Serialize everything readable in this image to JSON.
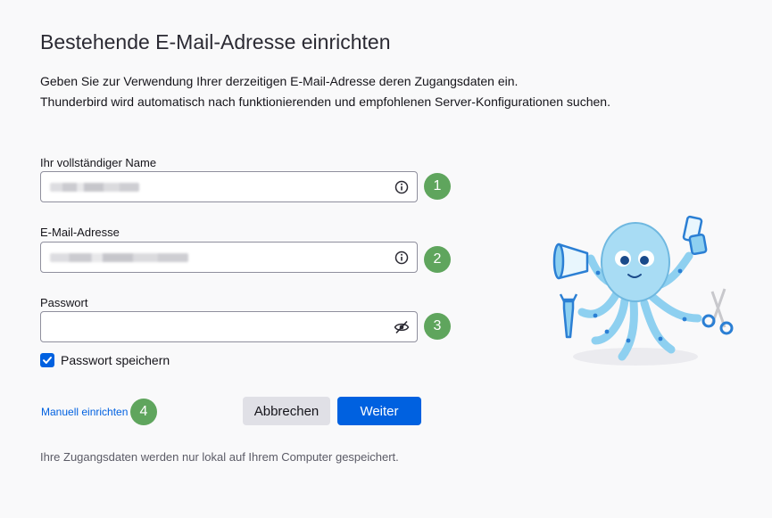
{
  "page": {
    "title": "Bestehende E-Mail-Adresse einrichten",
    "intro_line1": "Geben Sie zur Verwendung Ihrer derzeitigen E-Mail-Adresse deren Zugangsdaten ein.",
    "intro_line2": "Thunderbird wird automatisch nach funktionierenden und empfohlenen Server-Konfigurationen suchen."
  },
  "form": {
    "name_label": "Ihr vollständiger Name",
    "email_label": "E-Mail-Adresse",
    "password_label": "Passwort",
    "remember_label": "Passwort speichern",
    "remember_checked": true
  },
  "badges": [
    "1",
    "2",
    "3",
    "4"
  ],
  "actions": {
    "manual_label": "Manuell einrichten",
    "cancel_label": "Abbrechen",
    "next_label": "Weiter"
  },
  "footer": {
    "note": "Ihre Zugangsdaten werden nur lokal auf Ihrem Computer gespeichert."
  },
  "icons": {
    "name_field": "info-icon",
    "email_field": "info-icon",
    "password_field": "eye-slash-icon"
  },
  "colors": {
    "accent": "#0061e0",
    "badge": "#5fa55d",
    "mascot": "#8ed0f0"
  }
}
